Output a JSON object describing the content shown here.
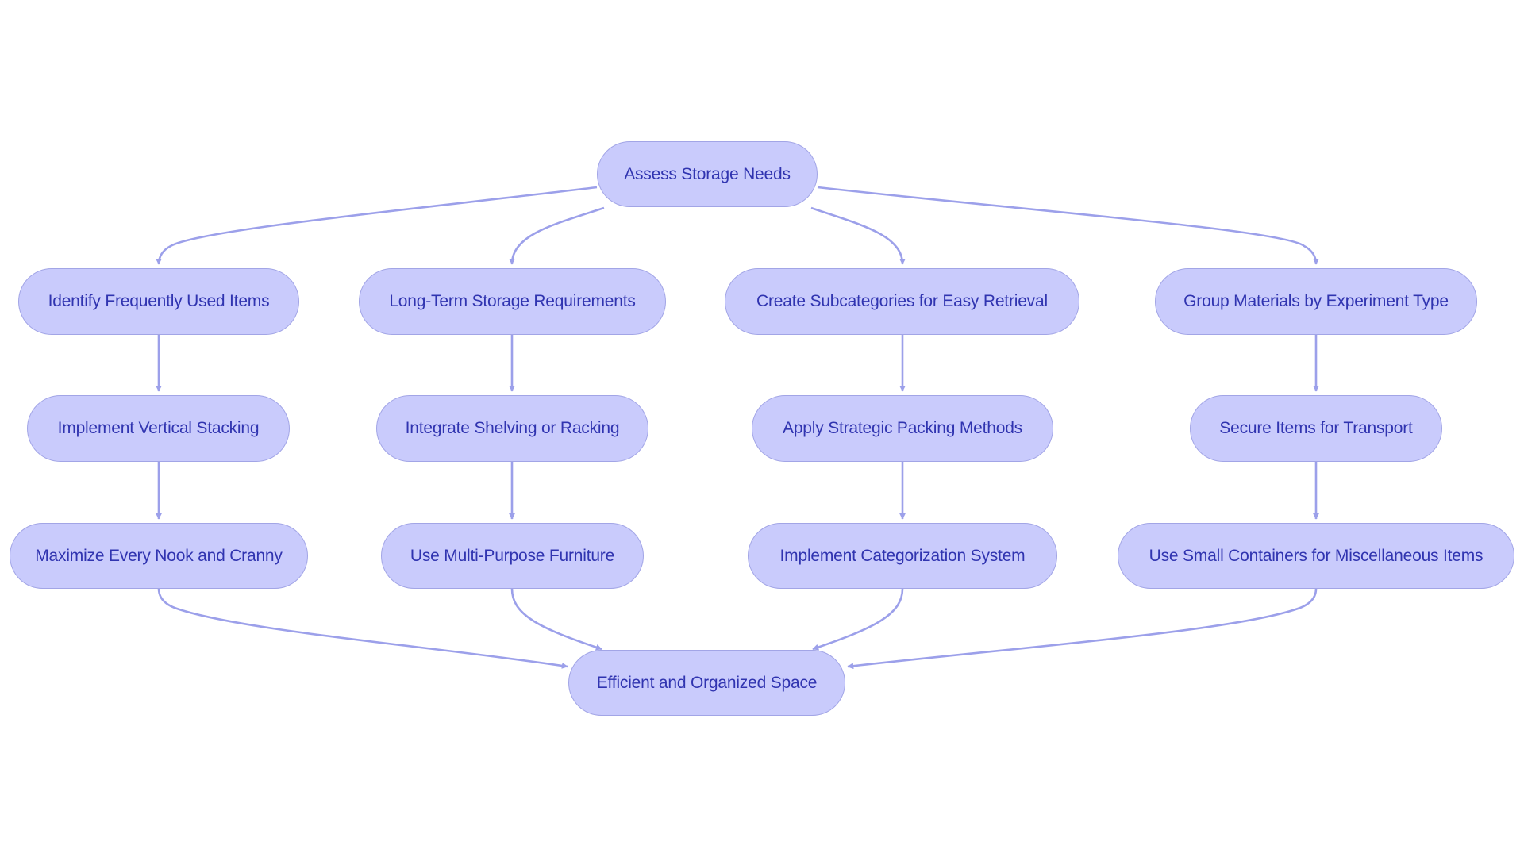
{
  "diagram": {
    "type": "flowchart",
    "colors": {
      "node_fill": "#c9cbfc",
      "node_stroke": "#a2a5e6",
      "node_text": "#3034b0",
      "edge": "#9ca0ea"
    },
    "nodes": [
      {
        "id": "root",
        "label": "Assess Storage Needs"
      },
      {
        "id": "a1",
        "label": "Identify Frequently Used Items"
      },
      {
        "id": "b1",
        "label": "Long-Term Storage Requirements"
      },
      {
        "id": "c1",
        "label": "Create Subcategories for Easy Retrieval"
      },
      {
        "id": "d1",
        "label": "Group Materials by Experiment Type"
      },
      {
        "id": "a2",
        "label": "Implement Vertical Stacking"
      },
      {
        "id": "b2",
        "label": "Integrate Shelving or Racking"
      },
      {
        "id": "c2",
        "label": "Apply Strategic Packing Methods"
      },
      {
        "id": "d2",
        "label": "Secure Items for Transport"
      },
      {
        "id": "a3",
        "label": "Maximize Every Nook and Cranny"
      },
      {
        "id": "b3",
        "label": "Use Multi-Purpose Furniture"
      },
      {
        "id": "c3",
        "label": "Implement Categorization System"
      },
      {
        "id": "d3",
        "label": "Use Small Containers for Miscellaneous Items"
      },
      {
        "id": "end",
        "label": "Efficient and Organized Space"
      }
    ],
    "edges": [
      {
        "from": "root",
        "to": "a1"
      },
      {
        "from": "root",
        "to": "b1"
      },
      {
        "from": "root",
        "to": "c1"
      },
      {
        "from": "root",
        "to": "d1"
      },
      {
        "from": "a1",
        "to": "a2"
      },
      {
        "from": "b1",
        "to": "b2"
      },
      {
        "from": "c1",
        "to": "c2"
      },
      {
        "from": "d1",
        "to": "d2"
      },
      {
        "from": "a2",
        "to": "a3"
      },
      {
        "from": "b2",
        "to": "b3"
      },
      {
        "from": "c2",
        "to": "c3"
      },
      {
        "from": "d2",
        "to": "d3"
      },
      {
        "from": "a3",
        "to": "end"
      },
      {
        "from": "b3",
        "to": "end"
      },
      {
        "from": "c3",
        "to": "end"
      },
      {
        "from": "d3",
        "to": "end"
      }
    ]
  }
}
